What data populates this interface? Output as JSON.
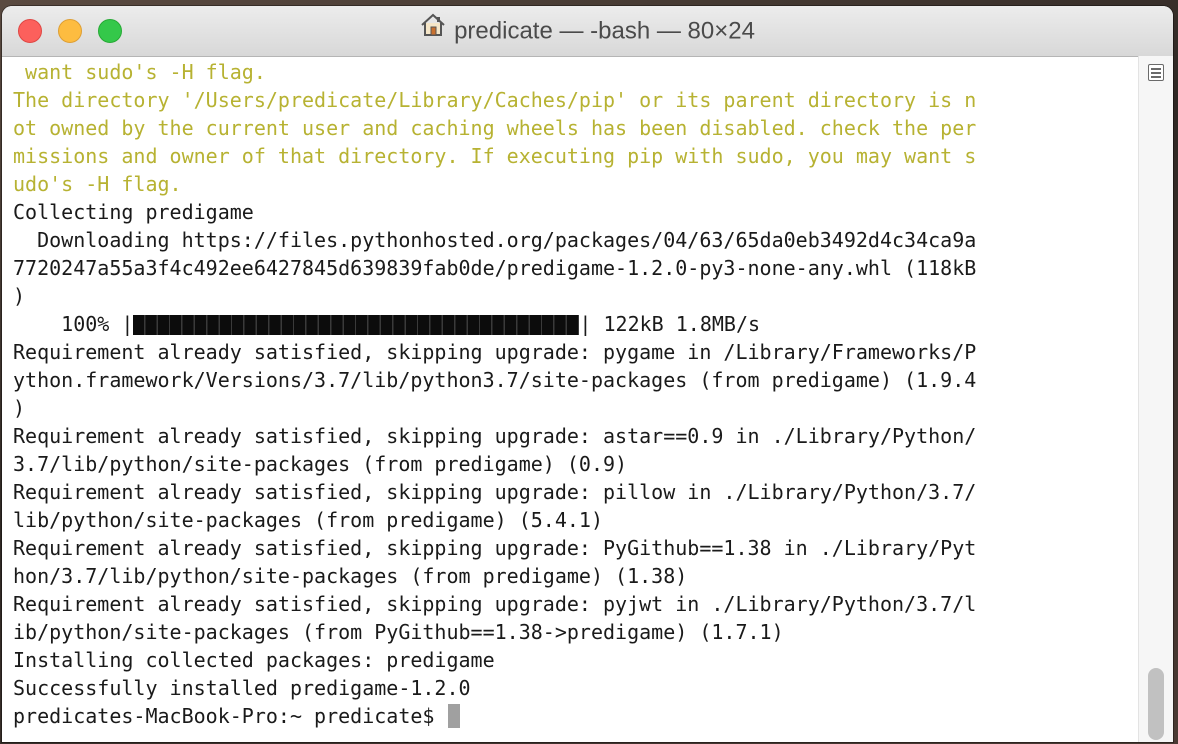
{
  "window": {
    "title": "predicate — -bash — 80×24"
  },
  "terminal": {
    "lines": [
      {
        "text": " want sudo's -H flag.",
        "style": "warn"
      },
      {
        "text": "The directory '/Users/predicate/Library/Caches/pip' or its parent directory is n",
        "style": "warn"
      },
      {
        "text": "ot owned by the current user and caching wheels has been disabled. check the per",
        "style": "warn"
      },
      {
        "text": "missions and owner of that directory. If executing pip with sudo, you may want s",
        "style": "warn"
      },
      {
        "text": "udo's -H flag.",
        "style": "warn"
      },
      {
        "text": "Collecting predigame",
        "style": "normal"
      },
      {
        "text": "  Downloading https://files.pythonhosted.org/packages/04/63/65da0eb3492d4c34ca9a",
        "style": "normal"
      },
      {
        "text": "7720247a55a3f4c492ee6427845d639839fab0de/predigame-1.2.0-py3-none-any.whl (118kB",
        "style": "normal"
      },
      {
        "text": ")",
        "style": "normal"
      },
      {
        "text": "",
        "style": "progress"
      },
      {
        "text": "Requirement already satisfied, skipping upgrade: pygame in /Library/Frameworks/P",
        "style": "normal"
      },
      {
        "text": "ython.framework/Versions/3.7/lib/python3.7/site-packages (from predigame) (1.9.4",
        "style": "normal"
      },
      {
        "text": ")",
        "style": "normal"
      },
      {
        "text": "Requirement already satisfied, skipping upgrade: astar==0.9 in ./Library/Python/",
        "style": "normal"
      },
      {
        "text": "3.7/lib/python/site-packages (from predigame) (0.9)",
        "style": "normal"
      },
      {
        "text": "Requirement already satisfied, skipping upgrade: pillow in ./Library/Python/3.7/",
        "style": "normal"
      },
      {
        "text": "lib/python/site-packages (from predigame) (5.4.1)",
        "style": "normal"
      },
      {
        "text": "Requirement already satisfied, skipping upgrade: PyGithub==1.38 in ./Library/Pyt",
        "style": "normal"
      },
      {
        "text": "hon/3.7/lib/python/site-packages (from predigame) (1.38)",
        "style": "normal"
      },
      {
        "text": "Requirement already satisfied, skipping upgrade: pyjwt in ./Library/Python/3.7/l",
        "style": "normal"
      },
      {
        "text": "ib/python/site-packages (from PyGithub==1.38->predigame) (1.7.1)",
        "style": "normal"
      },
      {
        "text": "Installing collected packages: predigame",
        "style": "normal"
      },
      {
        "text": "Successfully installed predigame-1.2.0",
        "style": "normal"
      }
    ],
    "progress": {
      "prefix": "    100% |",
      "suffix": "| 122kB 1.8MB/s",
      "percent": 100
    },
    "prompt": "predicates-MacBook-Pro:~ predicate$ "
  },
  "colors": {
    "warning_text": "#b7b232",
    "normal_text": "#1a1a1a",
    "close": "#fc605c",
    "minimize": "#fdbc40",
    "maximize": "#34c84a"
  },
  "icons": {
    "title_icon": "home-icon",
    "scrollbar_menu": "menu-icon"
  }
}
